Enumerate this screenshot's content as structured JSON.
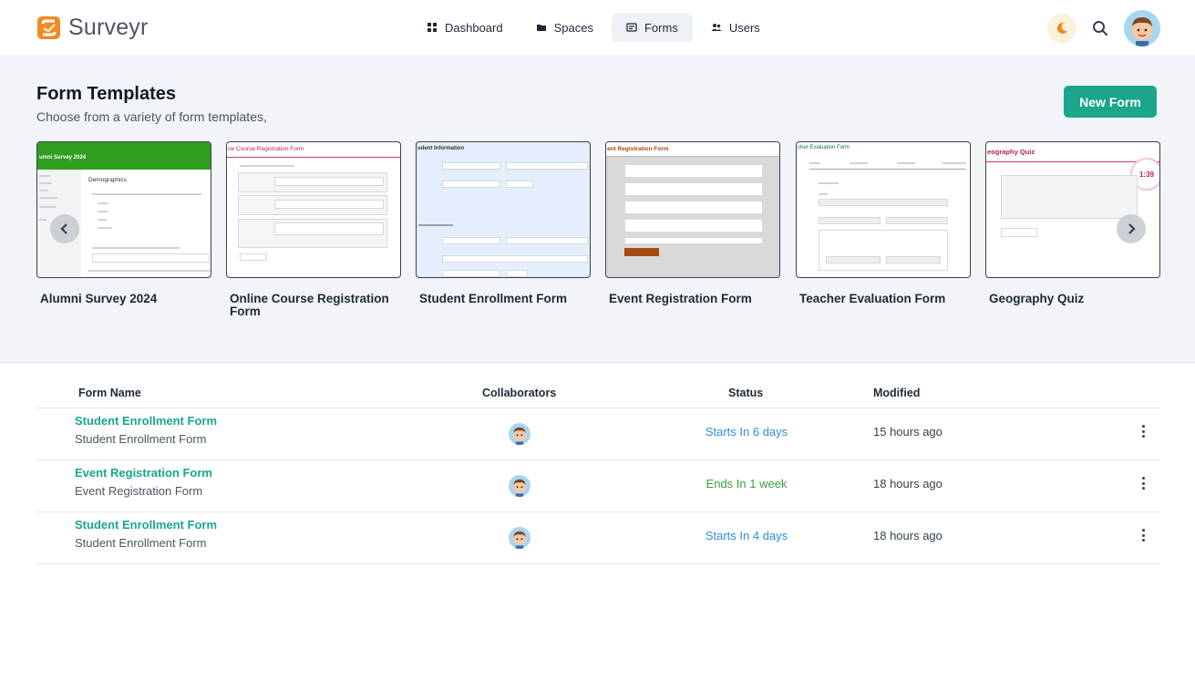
{
  "app": {
    "name": "Surveyr",
    "accent": "#1aa68a",
    "logo_color": "#f08a24"
  },
  "nav": [
    {
      "label": "Dashboard",
      "icon": "grid-icon",
      "active": false
    },
    {
      "label": "Spaces",
      "icon": "folder-icon",
      "active": false
    },
    {
      "label": "Forms",
      "icon": "form-icon",
      "active": true
    },
    {
      "label": "Users",
      "icon": "users-icon",
      "active": false
    }
  ],
  "templates": {
    "title": "Form Templates",
    "subtitle": "Choose from a variety of form templates,",
    "new_form_label": "New Form",
    "items": [
      {
        "name": "Alumni Survey 2024",
        "header": "umni Survey 2024",
        "section": "Demographics"
      },
      {
        "name": "Online Course Registration Form",
        "header": "ne Course Registration Form"
      },
      {
        "name": "Student Enrollment Form",
        "header": "udent Information"
      },
      {
        "name": "Event Registration Form",
        "header": "ent Registration Form"
      },
      {
        "name": "Teacher Evaluation Form",
        "header": "cher Evaluation Form"
      },
      {
        "name": "Geography Quiz",
        "header": "eography Quiz",
        "timer": "1:39"
      }
    ]
  },
  "table": {
    "columns": [
      "Form Name",
      "Collaborators",
      "Status",
      "Modified"
    ],
    "rows": [
      {
        "name": "Student Enrollment Form",
        "description": "Student Enrollment Form",
        "status": "Starts In 6 days",
        "status_color": "#2d8fd6",
        "modified": "15 hours ago"
      },
      {
        "name": "Event Registration Form",
        "description": "Event Registration Form",
        "status": "Ends In 1 week",
        "status_color": "#3aa13a",
        "modified": "18 hours ago"
      },
      {
        "name": "Student Enrollment Form",
        "description": "Student Enrollment Form",
        "status": "Starts In 4 days",
        "status_color": "#2d8fd6",
        "modified": "18 hours ago"
      }
    ]
  }
}
